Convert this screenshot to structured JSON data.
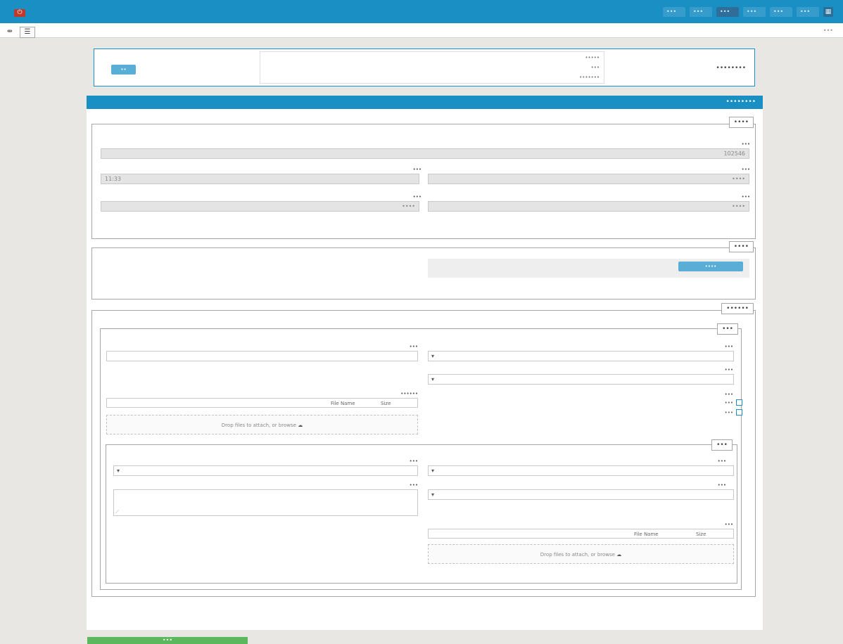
{
  "topbar": {
    "power_glyph": "⏻",
    "nav": [
      "•••",
      "•••",
      "•••",
      "•••",
      "•••",
      "•••"
    ],
    "active_index": 2,
    "grid_glyph": "▦"
  },
  "subbar": {
    "menu_glyph": "☰",
    "expand_glyph": "⇹",
    "breadcrumb": "•••"
  },
  "summary": {
    "title": "••••••••",
    "line1": "•••••",
    "line2": "•••",
    "line3": "•••••••",
    "back_button": "••"
  },
  "main_header": "••••••••",
  "request_info": {
    "legend": "••••",
    "tracking_label": "•••",
    "tracking_value": "102546",
    "date_label": "•••",
    "date_value": "••••",
    "time_label": "•••",
    "time_value": "11:33",
    "applicant_label": "•••",
    "applicant_value": "••••",
    "status_label": "•••",
    "status_value": "••••"
  },
  "identity": {
    "legend": "••••",
    "button": "••••"
  },
  "permit": {
    "legend": "••••••",
    "plan": {
      "legend": "•••",
      "request_type": "•••",
      "unit_type": "•••",
      "unit_name": "•••",
      "ownership": "•••",
      "opt1": "•••",
      "opt2": "•••",
      "docs": "••••••",
      "file_name": "File Name",
      "file_size": "Size",
      "drop_text": "Drop files to attach, or browse"
    },
    "address": {
      "legend": "•••",
      "province": "•••",
      "county": "•••",
      "area": "•••",
      "exact": "•••",
      "photos": "•••",
      "file_name": "File Name",
      "file_size": "Size",
      "drop_text": "Drop files to attach, or browse"
    }
  },
  "submit": "•••"
}
